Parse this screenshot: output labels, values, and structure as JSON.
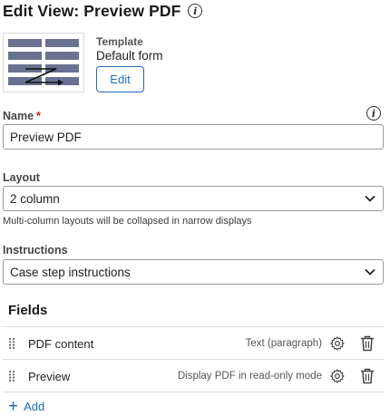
{
  "header": {
    "title": "Edit View: Preview PDF",
    "info_icon": "info-icon"
  },
  "template": {
    "label": "Template",
    "value": "Default form",
    "edit_label": "Edit",
    "thumbnail_icon": "form-layout-thumbnail"
  },
  "name_field": {
    "label": "Name",
    "required_mark": "*",
    "value": "Preview PDF",
    "info_icon": "info-icon"
  },
  "layout_field": {
    "label": "Layout",
    "value": "2 column",
    "helper": "Multi-column layouts will be collapsed in narrow displays"
  },
  "instructions_field": {
    "label": "Instructions",
    "value": "Case step instructions"
  },
  "fields_section": {
    "heading": "Fields",
    "rows": [
      {
        "name": "PDF content",
        "type": "Text (paragraph)"
      },
      {
        "name": "Preview",
        "type": "Display PDF in read-only mode"
      }
    ],
    "add_label": "Add"
  },
  "colors": {
    "accent": "#1d6bb6",
    "required": "#c41e1e",
    "thumbnail_bar": "#6b7190",
    "border": "#9a9a9a"
  }
}
